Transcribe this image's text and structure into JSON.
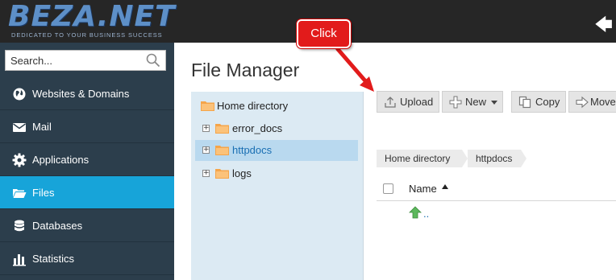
{
  "brand": {
    "name": "BEZA.NET",
    "tagline": "DEDICATED TO YOUR BUSINESS SUCCESS",
    "logo_color": "#5d8fc7"
  },
  "topbar": {
    "back_icon": "arrow-left-icon"
  },
  "sidebar": {
    "search_placeholder": "Search...",
    "items": [
      {
        "label": "Websites & Domains",
        "icon": "globe-icon",
        "active": false
      },
      {
        "label": "Mail",
        "icon": "envelope-icon",
        "active": false
      },
      {
        "label": "Applications",
        "icon": "gear-icon",
        "active": false
      },
      {
        "label": "Files",
        "icon": "folder-open-icon",
        "active": true
      },
      {
        "label": "Databases",
        "icon": "database-icon",
        "active": false
      },
      {
        "label": "Statistics",
        "icon": "bar-chart-icon",
        "active": false
      }
    ],
    "active_color": "#17a4d9"
  },
  "main": {
    "title": "File Manager",
    "tree": [
      {
        "label": "Home directory",
        "expandable": false,
        "selected": false
      },
      {
        "label": "error_docs",
        "expandable": true,
        "selected": false
      },
      {
        "label": "httpdocs",
        "expandable": true,
        "selected": true
      },
      {
        "label": "logs",
        "expandable": true,
        "selected": false
      }
    ],
    "toolbar": {
      "upload": "Upload",
      "new": "New",
      "copy": "Copy",
      "move": "Move"
    },
    "breadcrumb": [
      "Home directory",
      "httpdocs"
    ],
    "table": {
      "column_name": "Name",
      "up_row_label": ".."
    }
  },
  "callout": {
    "text": "Click",
    "color": "#e21b1b"
  }
}
